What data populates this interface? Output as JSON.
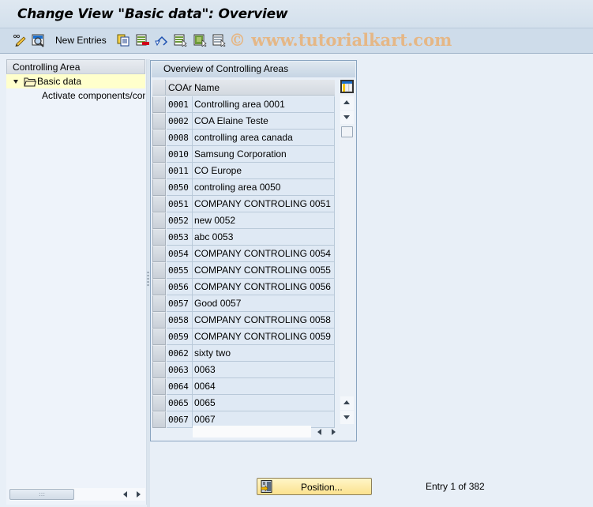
{
  "window": {
    "title": "Change View \"Basic data\": Overview"
  },
  "toolbar": {
    "new_entries_label": "New Entries",
    "icons": [
      "change-display-icon",
      "details-icon",
      "copy-icon",
      "delete-icon",
      "undo-change-icon",
      "select-all-icon",
      "select-block-icon",
      "deselect-all-icon"
    ],
    "watermark": "© www.tutorialkart.com"
  },
  "tree": {
    "header": "Controlling Area",
    "nodes": [
      {
        "label": "Basic data",
        "expanded": true,
        "selected": true,
        "level": 0
      },
      {
        "label": "Activate components/control indicators",
        "expanded": false,
        "selected": false,
        "level": 1
      }
    ]
  },
  "table": {
    "caption": "Overview of Controlling Areas",
    "columns": [
      "COAr",
      "Name"
    ],
    "rows": [
      {
        "key": "0001",
        "name": "Controlling area 0001"
      },
      {
        "key": "0002",
        "name": "COA Elaine Teste"
      },
      {
        "key": "0008",
        "name": "controlling area canada"
      },
      {
        "key": "0010",
        "name": "Samsung Corporation"
      },
      {
        "key": "0011",
        "name": "CO Europe"
      },
      {
        "key": "0050",
        "name": "controling area 0050"
      },
      {
        "key": "0051",
        "name": "COMPANY CONTROLING 0051"
      },
      {
        "key": "0052",
        "name": "new 0052"
      },
      {
        "key": "0053",
        "name": "abc 0053"
      },
      {
        "key": "0054",
        "name": "COMPANY CONTROLING 0054"
      },
      {
        "key": "0055",
        "name": "COMPANY CONTROLING 0055"
      },
      {
        "key": "0056",
        "name": "COMPANY CONTROLING 0056"
      },
      {
        "key": "0057",
        "name": "Good 0057"
      },
      {
        "key": "0058",
        "name": "COMPANY CONTROLING 0058"
      },
      {
        "key": "0059",
        "name": "COMPANY CONTROLING 0059"
      },
      {
        "key": "0062",
        "name": "sixty two"
      },
      {
        "key": "0063",
        "name": "0063"
      },
      {
        "key": "0064",
        "name": "0064"
      },
      {
        "key": "0065",
        "name": "0065"
      },
      {
        "key": "0067",
        "name": "0067"
      }
    ]
  },
  "footer": {
    "position_button_label": "Position...",
    "entry_info": "Entry 1 of 382"
  },
  "colors": {
    "title_bg": "#dfe8f1",
    "toolbar_bg": "#cedcea",
    "body_bg": "#e8eff7",
    "cell_bg": "#dfe9f4",
    "selected_tree_bg": "#ffffcc",
    "button_bg": "#fbe28e",
    "watermark": "#e8b37c"
  }
}
